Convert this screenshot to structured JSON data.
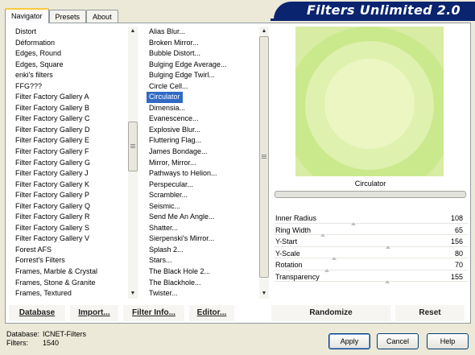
{
  "tabs": [
    "Navigator",
    "Presets",
    "About"
  ],
  "banner": "Filters Unlimited 2.0",
  "categories": [
    "Distort",
    "Déformation",
    "Edges, Round",
    "Edges, Square",
    "enki's filters",
    "FFG???",
    "Filter Factory Gallery A",
    "Filter Factory Gallery B",
    "Filter Factory Gallery C",
    "Filter Factory Gallery D",
    "Filter Factory Gallery E",
    "Filter Factory Gallery F",
    "Filter Factory Gallery G",
    "Filter Factory Gallery J",
    "Filter Factory Gallery K",
    "Filter Factory Gallery P",
    "Filter Factory Gallery Q",
    "Filter Factory Gallery R",
    "Filter Factory Gallery S",
    "Filter Factory Gallery V",
    "Forest AFS",
    "Forrest's Filters",
    "Frames, Marble & Crystal",
    "Frames, Stone & Granite",
    "Frames, Textured"
  ],
  "filters": [
    "Alias Blur...",
    "Broken Mirror...",
    "Bubble Distort...",
    "Bulging Edge Average...",
    "Bulging Edge Twirl...",
    "Circle Cell...",
    "Circulator",
    "Dimensia...",
    "Evanescence...",
    "Explosive Blur...",
    "Fluttering Flag...",
    "James Bondage...",
    "Mirror, Mirror...",
    "Pathways to Helion...",
    "Perspecular...",
    "Scrambler...",
    "Seismic...",
    "Send Me An Angle...",
    "Shatter...",
    "Sierpenski's Mirror...",
    "Splash 2...",
    "Stars...",
    "The Black Hole 2...",
    "The Blackhole...",
    "Twister..."
  ],
  "selected_filter": "Circulator",
  "filter_name": "Circulator",
  "parameters": [
    {
      "name": "Inner Radius",
      "value": "108",
      "level": 108
    },
    {
      "name": "Ring Width",
      "value": "65",
      "level": 65
    },
    {
      "name": "Y-Start",
      "value": "156",
      "level": 156
    },
    {
      "name": "Y-Scale",
      "value": "80",
      "level": 80
    },
    {
      "name": "Rotation",
      "value": "70",
      "level": 70
    },
    {
      "name": "Transparency",
      "value": "155",
      "level": 155
    }
  ],
  "param_max": 255,
  "buttons": {
    "database": "Database",
    "import": "Import...",
    "filter_info": "Filter Info...",
    "editor": "Editor...",
    "randomize": "Randomize",
    "reset": "Reset"
  },
  "status": {
    "database_label": "Database:",
    "database_value": "ICNET-Filters",
    "filters_label": "Filters:",
    "filters_value": "1540"
  },
  "dialog": {
    "apply": "Apply",
    "cancel": "Cancel",
    "help": "Help"
  },
  "colors": {
    "selection": "#316ac5",
    "banner": "#0a2470",
    "preview_green": "#d9eca4"
  }
}
